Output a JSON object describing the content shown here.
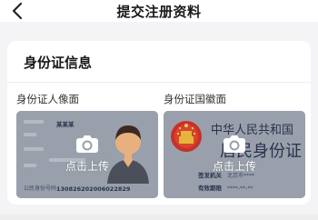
{
  "header": {
    "title": "提交注册资料",
    "back_icon": "chevron-left-icon"
  },
  "section": {
    "title": "身份证信息"
  },
  "id_cards": [
    {
      "label": "身份证人像面",
      "upload_text": "点击上传",
      "sample": {
        "name": "某某某",
        "id_number": "130826202006022829"
      }
    },
    {
      "label": "身份证国徽面",
      "upload_text": "点击上传",
      "sample": {
        "country": "中华人民共和国",
        "card_title": "居民身份证",
        "authority_label": "签发机关",
        "authority_value": "北京市****",
        "validity_label": "有效期限",
        "validity_value": "****-**-**"
      }
    }
  ],
  "colors": {
    "accent": "#1a1a1a",
    "tile_bg": "#9aa0ab",
    "page_bg": "#f4f4f6"
  }
}
